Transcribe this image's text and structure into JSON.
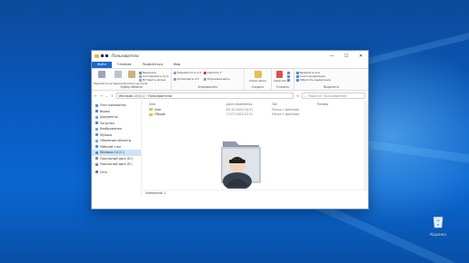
{
  "window": {
    "title": "Пользователи",
    "controls": [
      "—",
      "☐",
      "✕"
    ]
  },
  "tabs": [
    "Файл",
    "Главная",
    "Поделиться",
    "Вид"
  ],
  "ribbon": {
    "clipboard": {
      "label": "Буфер обмена",
      "pin": "Закрепить на панели быстрого доступа",
      "copy": "Копировать",
      "paste": "Вставить",
      "cut": "Вырезать",
      "copy_path": "Скопировать путь",
      "paste_shortcut": "Вставить ярлык"
    },
    "organize": {
      "label": "Упорядочить",
      "move": "Переместить в ▾",
      "copy_to": "Копировать в ▾",
      "delete": "Удалить ▾",
      "rename": "Переименовать"
    },
    "new": {
      "label": "Создать",
      "new_folder": "Новая папка"
    },
    "open": {
      "label": "Открыть",
      "properties": "Свойства"
    },
    "select": {
      "label": "Выделить",
      "select_all": "Выделить все",
      "select_none": "Снять выделение",
      "invert": "Обратить выделение"
    }
  },
  "address": {
    "path": "Windows 10 (C:)  ›  Пользователи",
    "search_placeholder": "Поиск в: Пользователи"
  },
  "nav": [
    {
      "label": "Этот компьютер",
      "color": "#4a90d9"
    },
    {
      "label": "Видео",
      "color": "#6a7fb5"
    },
    {
      "label": "Документы",
      "color": "#7aa0d0"
    },
    {
      "label": "Загрузки",
      "color": "#3a8fd8"
    },
    {
      "label": "Изображения",
      "color": "#6aa8d8"
    },
    {
      "label": "Музыка",
      "color": "#5a8fd0"
    },
    {
      "label": "Объемные объекты",
      "color": "#6ab0e0"
    },
    {
      "label": "Рабочий стол",
      "color": "#4a90d9"
    },
    {
      "label": "Windows 10 (C:)",
      "color": "#5a8ac0"
    },
    {
      "label": "Локальный диск (D:)",
      "color": "#888888"
    },
    {
      "label": "Локальный диск (E:)",
      "color": "#888888"
    },
    {
      "label": "Сеть",
      "color": "#4a80c0"
    }
  ],
  "columns": [
    "Имя",
    "Дата изменения",
    "Тип",
    "Размер"
  ],
  "files": [
    {
      "name": "User",
      "date": "09.10.2020 20:51",
      "type": "Папка с файлами"
    },
    {
      "name": "Общие",
      "date": "17.07.2020 22:51",
      "type": "Папка с файлами"
    }
  ],
  "status": "Элементов: 2",
  "desktop": {
    "recycle_bin": "Корзина"
  }
}
